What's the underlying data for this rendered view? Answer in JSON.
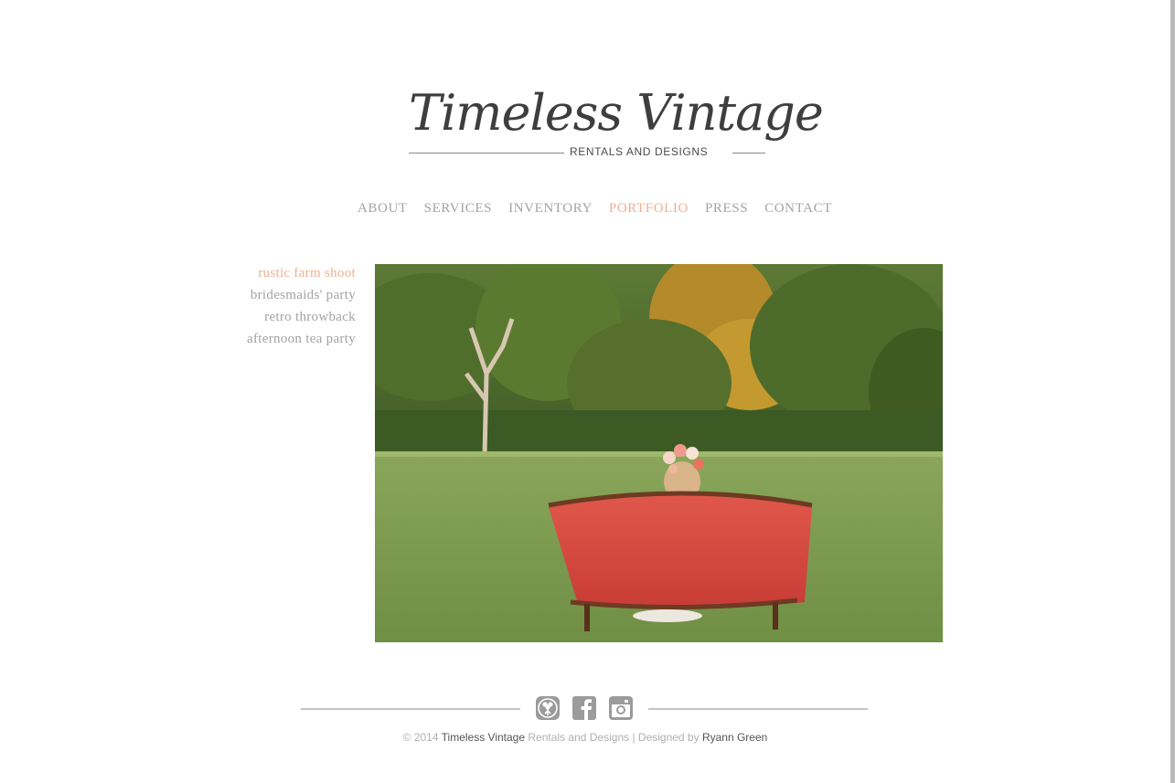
{
  "logo": {
    "script": "Timeless Vintage",
    "subtitle": "RENTALS AND DESIGNS"
  },
  "nav": {
    "items": [
      {
        "label": "ABOUT"
      },
      {
        "label": "SERVICES"
      },
      {
        "label": "INVENTORY"
      },
      {
        "label": "PORTFOLIO",
        "active": true
      },
      {
        "label": "PRESS"
      },
      {
        "label": "CONTACT"
      }
    ]
  },
  "portfolio": {
    "items": [
      {
        "label": "rustic farm shoot",
        "active": true
      },
      {
        "label": "bridesmaids' party"
      },
      {
        "label": "retro throwback"
      },
      {
        "label": "afternoon tea party"
      }
    ]
  },
  "social": {
    "icons": [
      "bouquet-icon",
      "facebook-icon",
      "instagram-icon"
    ]
  },
  "footer": {
    "copyright_prefix": "© 2014 ",
    "brand": "Timeless Vintage",
    "brand_suffix": " Rentals and Designs | Designed by ",
    "designer": "Ryann Green"
  },
  "colors": {
    "accent": "#f0b090",
    "nav_text": "#a3a3a3",
    "logo_text": "#3e3e3e"
  }
}
